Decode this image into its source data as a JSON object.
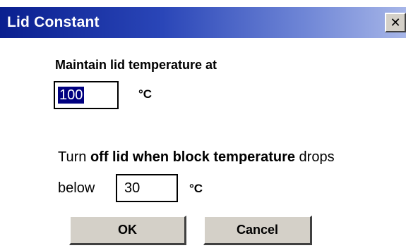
{
  "window": {
    "title": "Lid Constant",
    "close_glyph": "✕",
    "close_icon": "close-icon"
  },
  "maintain": {
    "label": "Maintain lid temperature at",
    "value": "100",
    "unit": "°C"
  },
  "turnoff": {
    "label_part1": "Turn ",
    "label_bold": "off lid when block temperature",
    "label_part2": " drops",
    "below_label": "below",
    "value": "30",
    "unit": "°C"
  },
  "buttons": {
    "ok_label": "OK",
    "cancel_label": "Cancel"
  },
  "colors": {
    "titlebar_start": "#0a1f8f",
    "titlebar_end": "#a7b6e8",
    "selection": "#000080",
    "button_face": "#d4d0c8"
  }
}
